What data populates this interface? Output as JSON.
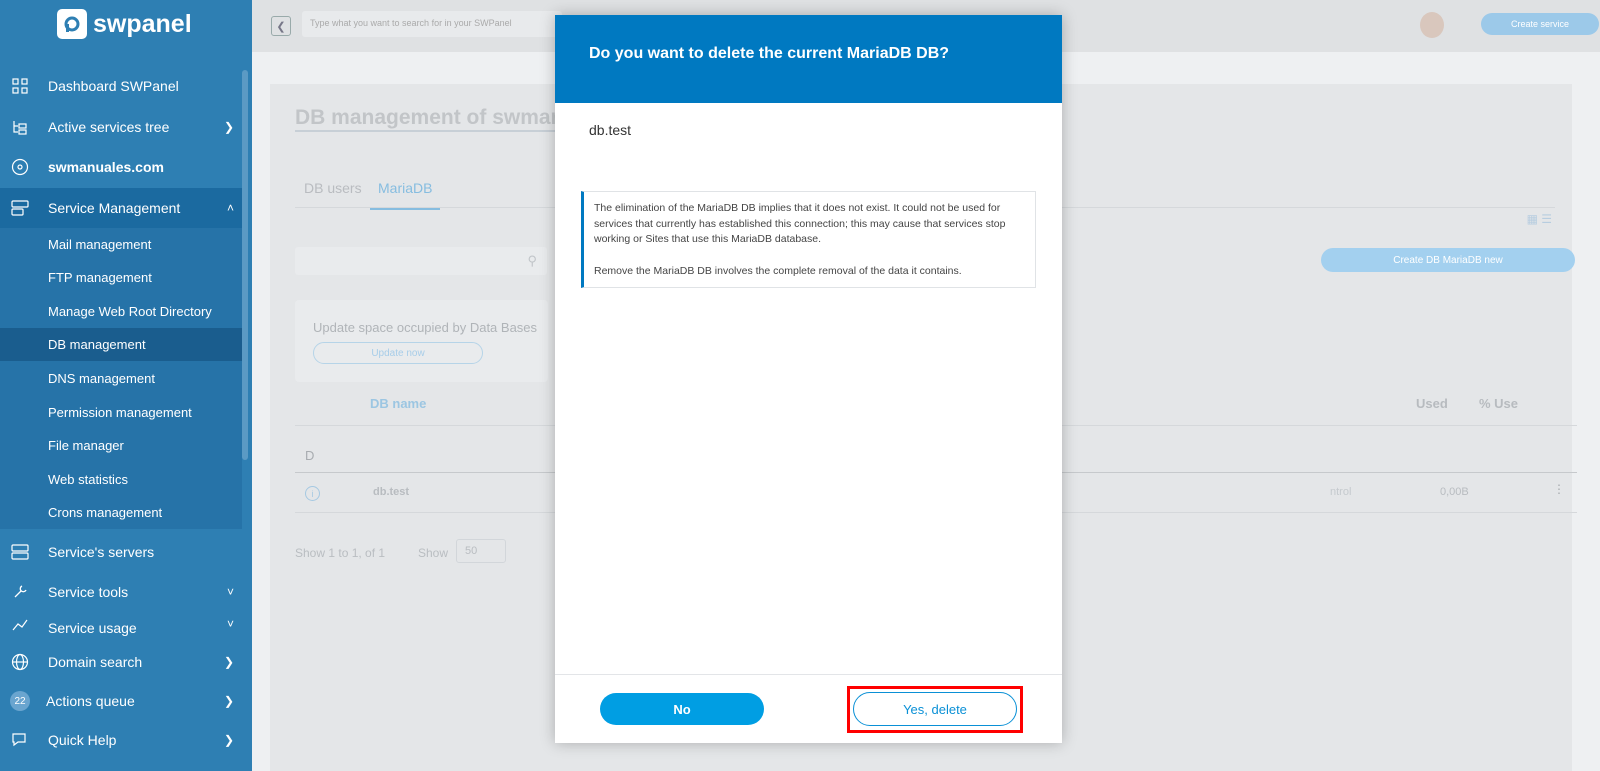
{
  "brand": {
    "name": "swpanel"
  },
  "sidebar": {
    "items": [
      {
        "label": "Dashboard SWPanel",
        "icon": "dashboard-icon"
      },
      {
        "label": "Active services tree",
        "icon": "tree-icon"
      },
      {
        "label": "swmanuales.com",
        "icon": "domain-icon"
      },
      {
        "label": "Service Management",
        "icon": "service-management-icon"
      },
      {
        "label": "Service's servers",
        "icon": "server-icon"
      },
      {
        "label": "Service tools",
        "icon": "wrench-icon"
      },
      {
        "label": "Service usage",
        "icon": "chart-icon"
      },
      {
        "label": "Domain search",
        "icon": "globe-icon"
      },
      {
        "label": "Actions queue",
        "icon": "queue-icon",
        "badge": "22"
      },
      {
        "label": "Quick Help",
        "icon": "help-icon"
      }
    ],
    "sub_items": [
      "Mail management",
      "FTP management",
      "Manage Web Root Directory",
      "DB management",
      "DNS management",
      "Permission management",
      "File manager",
      "Web statistics",
      "Crons management"
    ]
  },
  "topbar": {
    "search_placeholder": "Type what you want to search for in your SWPanel",
    "create_service": "Create service"
  },
  "page": {
    "title": "DB management of swmar",
    "tabs": [
      "DB users",
      "MariaDB"
    ],
    "create_db": "Create DB MariaDB new",
    "update_title": "Update space occupied by Data Bases",
    "update_button": "Update now",
    "columns": {
      "name": "DB name",
      "used": "Used",
      "percent": "% Use"
    },
    "group": "D",
    "row": {
      "name": "db.test",
      "control": "ntrol",
      "used": "0,00B"
    },
    "pager": {
      "text": "Show 1 to 1, of 1",
      "show": "Show",
      "page_size": "50"
    }
  },
  "modal": {
    "title": "Do you want to delete the current MariaDB DB?",
    "db_name": "db.test",
    "warning_1": "The elimination of the MariaDB DB implies that it does not exist. It could not be used for services that currently has established this connection; this may cause that services stop working or Sites that use this MariaDB database.",
    "warning_2": "Remove the MariaDB DB involves the complete removal of the data it contains.",
    "no_label": "No",
    "yes_label": "Yes, delete"
  },
  "colors": {
    "primary": "#0079c1",
    "accent": "#009ee3",
    "highlight": "#ff0000"
  }
}
